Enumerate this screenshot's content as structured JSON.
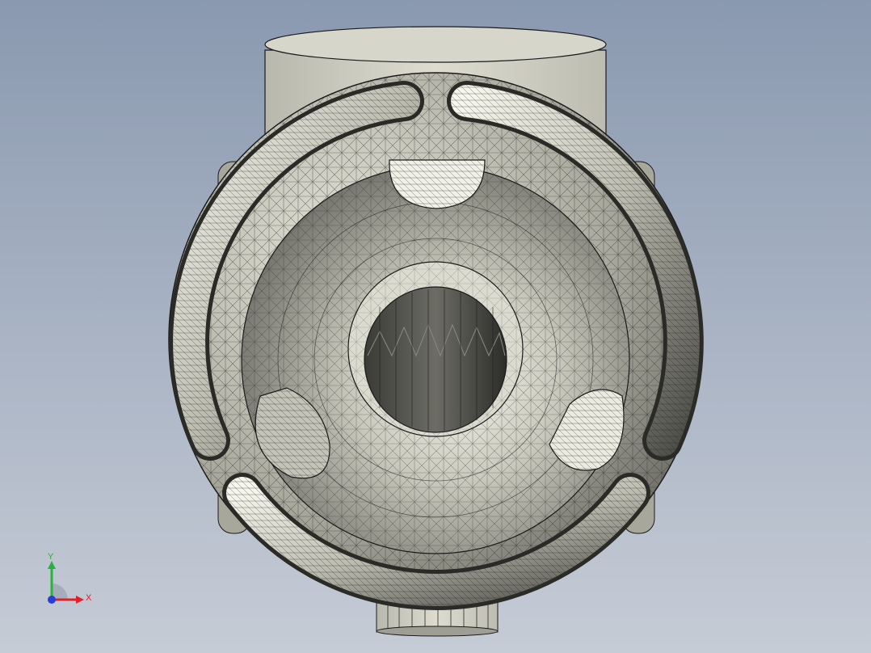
{
  "viewport": {
    "background_top": "#8a99b0",
    "background_bottom": "#c3c9d4",
    "model_fill": "#d9d8cc",
    "model_shadow": "#6e6e66",
    "edge_color": "#1a1a1a"
  },
  "model": {
    "icon": "3d-part-mesh"
  },
  "triad": {
    "x_label": "X",
    "y_label": "Y",
    "x_color": "#e0202a",
    "y_color": "#28b040",
    "z_color": "#2a3cd8"
  }
}
